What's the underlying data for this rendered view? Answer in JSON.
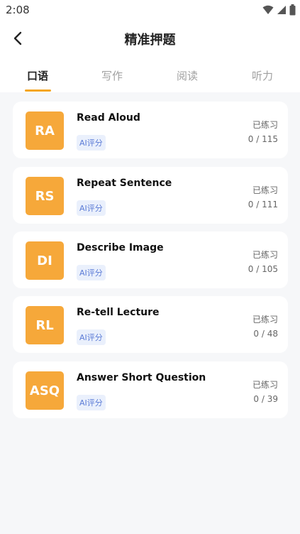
{
  "status": {
    "time": "2:08",
    "icons": [
      "wifi-icon",
      "signal-icon",
      "battery-icon"
    ]
  },
  "header": {
    "back_icon": "chevron-left-icon",
    "title": "精准押题"
  },
  "tabs": [
    {
      "label": "口语",
      "active": true
    },
    {
      "label": "写作",
      "active": false
    },
    {
      "label": "阅读",
      "active": false
    },
    {
      "label": "听力",
      "active": false
    }
  ],
  "colors": {
    "accent": "#f5a623",
    "badge": "#f6a83a",
    "tag_text": "#5b7bd6",
    "tag_bg": "#eaf0fc"
  },
  "items": [
    {
      "badge": "RA",
      "title": "Read Aloud",
      "tag": "AI评分",
      "practiced_label": "已练习",
      "progress": "0 / 115"
    },
    {
      "badge": "RS",
      "title": "Repeat Sentence",
      "tag": "AI评分",
      "practiced_label": "已练习",
      "progress": "0 / 111"
    },
    {
      "badge": "DI",
      "title": "Describe Image",
      "tag": "AI评分",
      "practiced_label": "已练习",
      "progress": "0 / 105"
    },
    {
      "badge": "RL",
      "title": "Re-tell Lecture",
      "tag": "AI评分",
      "practiced_label": "已练习",
      "progress": "0 / 48"
    },
    {
      "badge": "ASQ",
      "title": "Answer Short Question",
      "tag": "AI评分",
      "practiced_label": "已练习",
      "progress": "0 / 39"
    }
  ]
}
